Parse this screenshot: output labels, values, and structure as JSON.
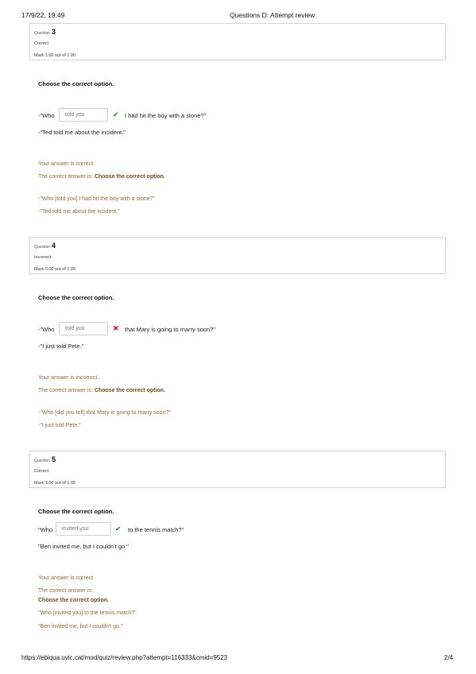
{
  "header": {
    "datetime": "17/9/22, 19:49",
    "title": "Questions D: Attempt review"
  },
  "footer": {
    "url": "https://ebiqua.uvic.cat/mod/quiz/review.php?attempt=116333&cmid=9523",
    "page": "2/4"
  },
  "questions": [
    {
      "label": "Question",
      "number": "3",
      "state": "Correct",
      "mark": "Mark 1.00 out of 1.00",
      "prompt": "Choose the correct option.",
      "pre": "-\"Who",
      "answer": "told you",
      "post": "I had hit the boy with a stone?\"",
      "reply": "-\"Ted told me about the incident.\"",
      "feedback": "Your answer is correct.",
      "correct_prefix": "The correct answer is:",
      "correct_text": "Choose the correct option.",
      "sol1": "-\"Who [told you] I had hit the boy with a stone?\"",
      "sol2": "-\"Ted told me about the incident.\""
    },
    {
      "label": "Question",
      "number": "4",
      "state": "Incorrect",
      "mark": "Mark 0.00 out of 1.00",
      "prompt": "Choose the correct option.",
      "pre": "-\"Who",
      "answer": "told you",
      "post": "that Mary is going to marry soon?\"",
      "reply": "-\"I just told Pete.\"",
      "feedback": "Your answer is incorrect.",
      "correct_prefix": "The correct answer is:",
      "correct_text": "Choose the correct option.",
      "sol1": "-\"Who [did you tell] that Mary is going to marry soon?\"",
      "sol2": "-\"I just told Pete.\""
    },
    {
      "label": "Question",
      "number": "5",
      "state": "Correct",
      "mark": "Mark 1.00 out of 1.00",
      "prompt": "Choose the correct option.",
      "pre": "\"Who",
      "answer": "invited you",
      "post": "to the tennis match?\"",
      "reply": "\"Ben invited me, but I couldn't go.\"",
      "feedback": "Your answer is correct.",
      "correct_prefix": "The correct answer is:",
      "correct_text": "Choose the correct option.",
      "sol1": "\"Who [invited you] to the tennis match?\"",
      "sol2": "\"Ben invited me, but I couldn't go.\""
    }
  ],
  "icons": {
    "correct": "check-icon",
    "incorrect": "cross-icon"
  },
  "colors": {
    "correct": "#2e7d32",
    "incorrect": "#c0392b",
    "feedback": "#8a6d3b"
  }
}
